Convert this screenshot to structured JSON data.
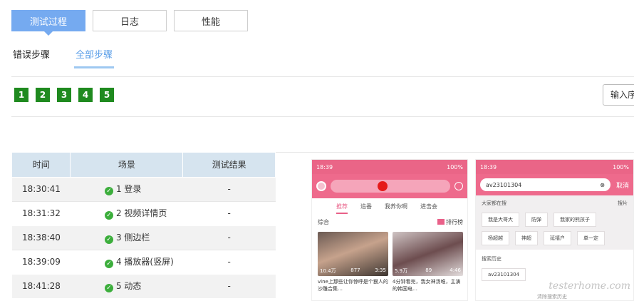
{
  "tabs": [
    "测试过程",
    "日志",
    "性能"
  ],
  "subtabs": [
    "错误步骤",
    "全部步骤"
  ],
  "steps": [
    "1",
    "2",
    "3",
    "4",
    "5"
  ],
  "seq_input": {
    "placeholder": "输入序"
  },
  "table": {
    "headers": [
      "时间",
      "场景",
      "测试结果"
    ],
    "rows": [
      {
        "time": "18:30:41",
        "scene": "1 登录",
        "result": "-"
      },
      {
        "time": "18:31:32",
        "scene": "2 视频详情页",
        "result": "-"
      },
      {
        "time": "18:38:40",
        "scene": "3 侧边栏",
        "result": "-"
      },
      {
        "time": "18:39:09",
        "scene": "4 播放器(竖屏)",
        "result": "-"
      },
      {
        "time": "18:41:28",
        "scene": "5 动态",
        "result": "-"
      }
    ]
  },
  "phone1": {
    "status_time": "18:39",
    "status_right": "100%",
    "nav": [
      "推荐",
      "追番",
      "我养你啊",
      "进击会"
    ],
    "section": "综合",
    "rank": "排行榜",
    "cards": [
      {
        "views": "10.4万",
        "danmaku": "877",
        "duration": "3:35",
        "title": "vine上那些让你惊呼是个狠人的沙雕合集…"
      },
      {
        "views": "5.9万",
        "danmaku": "89",
        "duration": "4:46",
        "title": "4分钟看完，我女神汤唯，主演的韩国电…"
      }
    ]
  },
  "phone2": {
    "status_time": "18:39",
    "status_right": "100%",
    "query": "av23101304",
    "cancel": "取消",
    "hot_title": "大家都在搜",
    "hot_more": "搜片",
    "chips": [
      "我是大哥大",
      "防弹",
      "我家的熊孩子",
      "杨超越",
      "神超",
      "延禧户",
      "单一定"
    ],
    "history_title": "搜索历史",
    "history_item": "av23101304",
    "clear": "清除搜索历史",
    "watermark": "testerhome.com"
  },
  "colors": {
    "accent": "#75aaf0",
    "step_green": "#1f8a1f",
    "pink": "#ee6a8c",
    "header_bg": "#d6e4ef"
  }
}
